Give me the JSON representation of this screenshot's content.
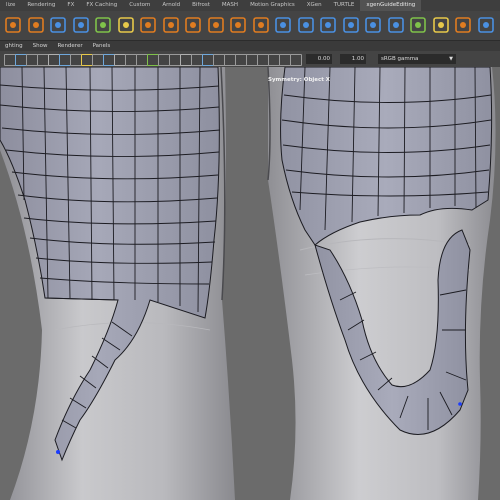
{
  "shelf": {
    "tabs": [
      {
        "label": "lize",
        "active": false
      },
      {
        "label": "Rendering",
        "active": false
      },
      {
        "label": "FX",
        "active": false
      },
      {
        "label": "FX Caching",
        "active": false
      },
      {
        "label": "Custom",
        "active": false
      },
      {
        "label": "Arnold",
        "active": false
      },
      {
        "label": "Bifrost",
        "active": false
      },
      {
        "label": "MASH",
        "active": false
      },
      {
        "label": "Motion Graphics",
        "active": false
      },
      {
        "label": "XGen",
        "active": false
      },
      {
        "label": "TURTLE",
        "active": false
      },
      {
        "label": "xgenGuideEditing",
        "active": true
      }
    ],
    "icons": [
      "text-tool-icon",
      "svg-tool-icon",
      "ik-handle-icon",
      "joint-icon",
      "bind-skin-icon",
      "graph-icon",
      "move-icon",
      "nurbs-icon",
      "cube-primitive-icon",
      "cylinder-icon",
      "sphere-icon",
      "plane-icon",
      "torus-icon",
      "combine-icon",
      "extrude-icon",
      "bevel-icon",
      "bridge-icon",
      "multicut-icon",
      "uv-editor-icon",
      "script-icon",
      "render-icon",
      "camera-icon"
    ],
    "accent_colors": {
      "orange": "#e07c20",
      "blue": "#4a90e2",
      "green": "#7fc24a",
      "yellow": "#e6c84a"
    }
  },
  "panel": {
    "menus": [
      "ghting",
      "Show",
      "Renderer",
      "Panels"
    ],
    "exposure_value": "0.00",
    "gamma_value": "1.00",
    "color_space": "sRGB gamma"
  },
  "viewport": {
    "hud_label": "Symmetry: Object X"
  }
}
